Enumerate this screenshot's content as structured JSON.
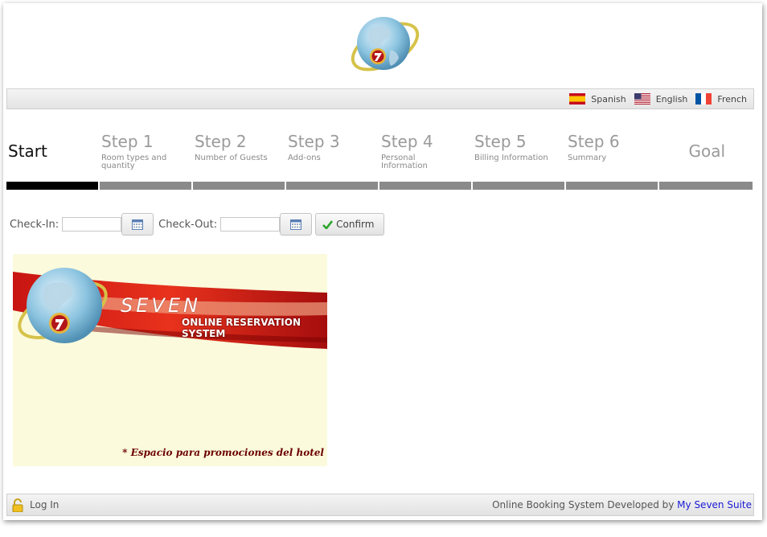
{
  "languages": [
    {
      "label": "Spanish",
      "flag": "es-flag-icon"
    },
    {
      "label": "English",
      "flag": "us-flag-icon"
    },
    {
      "label": "French",
      "flag": "fr-flag-icon"
    }
  ],
  "steps": [
    {
      "title": "Start",
      "subtitle": ""
    },
    {
      "title": "Step 1",
      "subtitle": "Room types and quantity"
    },
    {
      "title": "Step 2",
      "subtitle": "Number of Guests"
    },
    {
      "title": "Step 3",
      "subtitle": "Add-ons"
    },
    {
      "title": "Step 4",
      "subtitle": "Personal Information"
    },
    {
      "title": "Step 5",
      "subtitle": "Billing Information"
    },
    {
      "title": "Step 6",
      "subtitle": "Summary"
    },
    {
      "title": "Goal",
      "subtitle": ""
    }
  ],
  "active_step": "Start",
  "dates": {
    "checkin_label": "Check-In:",
    "checkin_value": "",
    "checkout_label": "Check-Out:",
    "checkout_value": "",
    "confirm_label": "Confirm"
  },
  "promo": {
    "brand": "SEVEN",
    "tagline_1": "ONLINE RESERVATION",
    "tagline_2": "SYSTEM",
    "caption": "* Espacio para  promociones del hotel"
  },
  "footer": {
    "login_label": "Log In",
    "credit_text": "Online Booking System Developed by ",
    "credit_link": "My Seven Suite"
  },
  "colors": {
    "active_step": "#000000",
    "inactive_step": "#8a8a8a",
    "link": "#1a1ad6",
    "promo_bg": "#fbfadc",
    "caption": "#6b0000"
  }
}
